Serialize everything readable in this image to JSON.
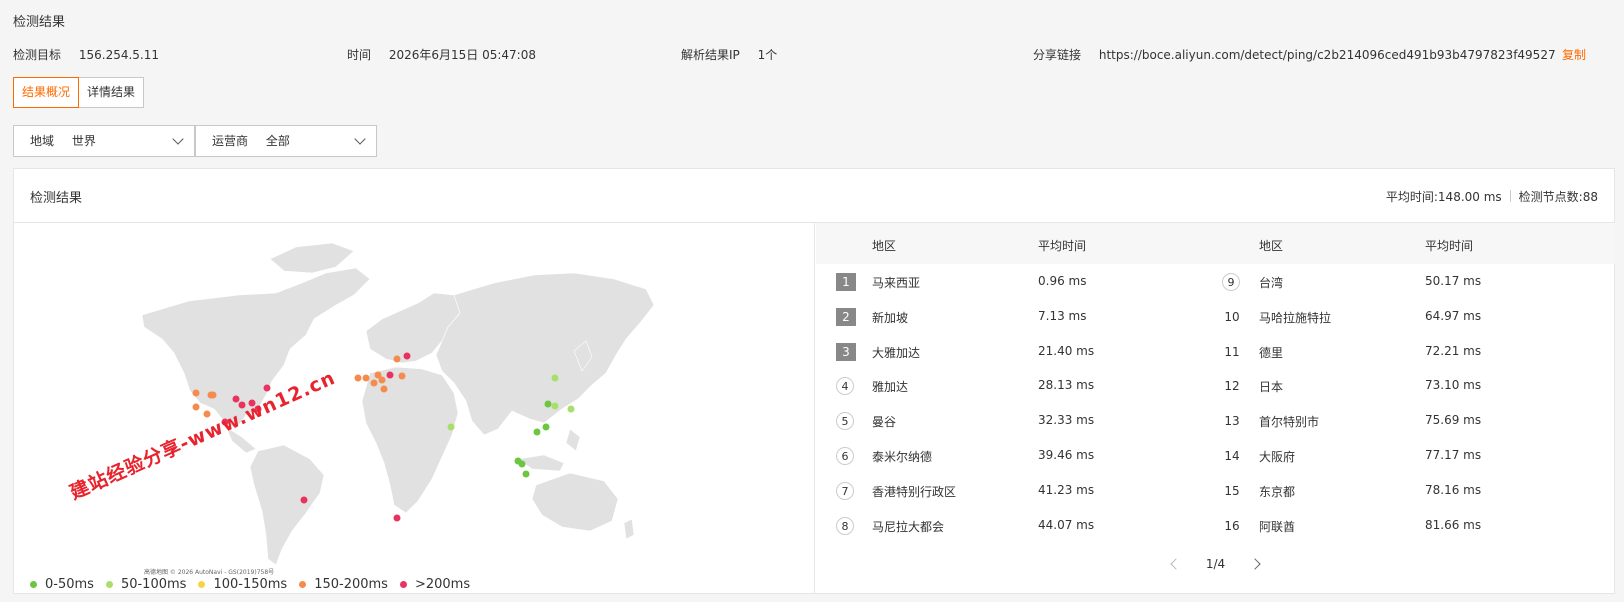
{
  "page_title": "检测结果",
  "info": {
    "target_label": "检测目标",
    "target_value": "156.254.5.11",
    "time_label": "时间",
    "time_value": "2026年6月15日 05:47:08",
    "resolve_label": "解析结果IP",
    "resolve_value": "1个",
    "share_label": "分享链接",
    "share_value": "https://boce.aliyun.com/detect/ping/c2b214096ced491b93b4797823f49527",
    "copy_label": "复制"
  },
  "tabs": [
    {
      "label": "结果概况",
      "active": true
    },
    {
      "label": "详情结果",
      "active": false
    }
  ],
  "filters": {
    "region_label": "地域",
    "region_value": "世界",
    "isp_label": "运营商",
    "isp_value": "全部"
  },
  "panel": {
    "title": "检测结果",
    "avg_time": "平均时间:148.00 ms",
    "node_count": "检测节点数:88"
  },
  "watermark": "建站经验分享-www.wn12.cn",
  "map_attribution": "高德地图 © 2026 AutoNavi - GS(2019)758号",
  "legend": [
    {
      "label": "0-50ms",
      "color": "#6cc63f"
    },
    {
      "label": "50-100ms",
      "color": "#a8df6b"
    },
    {
      "label": "100-150ms",
      "color": "#f7d443"
    },
    {
      "label": "150-200ms",
      "color": "#f58b4c"
    },
    {
      "label": ">200ms",
      "color": "#e8325f"
    }
  ],
  "table": {
    "headers": {
      "region": "地区",
      "avg": "平均时间"
    },
    "left_rows": [
      {
        "rank": "1",
        "region": "马来西亚",
        "avg": "0.96 ms"
      },
      {
        "rank": "2",
        "region": "新加坡",
        "avg": "7.13 ms"
      },
      {
        "rank": "3",
        "region": "大雅加达",
        "avg": "21.40 ms"
      },
      {
        "rank": "4",
        "region": "雅加达",
        "avg": "28.13 ms"
      },
      {
        "rank": "5",
        "region": "曼谷",
        "avg": "32.33 ms"
      },
      {
        "rank": "6",
        "region": "泰米尔纳德",
        "avg": "39.46 ms"
      },
      {
        "rank": "7",
        "region": "香港特别行政区",
        "avg": "41.23 ms"
      },
      {
        "rank": "8",
        "region": "马尼拉大都会",
        "avg": "44.07 ms"
      }
    ],
    "right_rows": [
      {
        "rank": "9",
        "region": "台湾",
        "avg": "50.17 ms"
      },
      {
        "rank": "10",
        "region": "马哈拉施特拉",
        "avg": "64.97 ms"
      },
      {
        "rank": "11",
        "region": "德里",
        "avg": "72.21 ms"
      },
      {
        "rank": "12",
        "region": "日本",
        "avg": "73.10 ms"
      },
      {
        "rank": "13",
        "region": "首尔特别市",
        "avg": "75.69 ms"
      },
      {
        "rank": "14",
        "region": "大阪府",
        "avg": "77.17 ms"
      },
      {
        "rank": "15",
        "region": "东京都",
        "avg": "78.16 ms"
      },
      {
        "rank": "16",
        "region": "阿联酋",
        "avg": "81.66 ms"
      }
    ]
  },
  "pager": {
    "text": "1/4"
  }
}
